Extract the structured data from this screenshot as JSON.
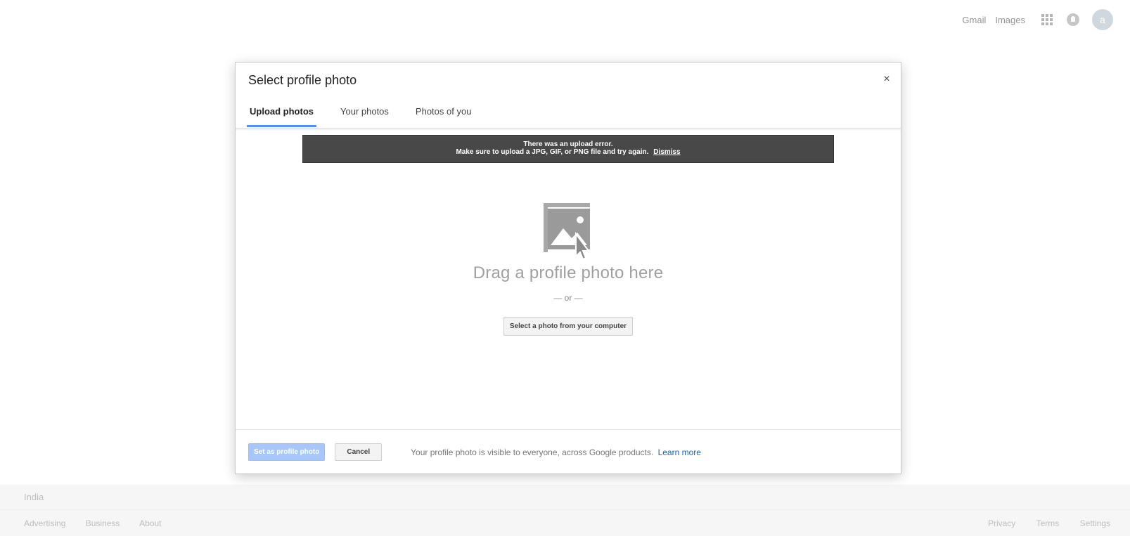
{
  "topbar": {
    "gmail": "Gmail",
    "images": "Images",
    "apps_icon": "apps-grid-icon",
    "notifications_icon": "bell-icon",
    "avatar_letter": "a"
  },
  "dialog": {
    "title": "Select profile photo",
    "close_label": "×",
    "tabs": [
      {
        "label": "Upload photos",
        "active": true
      },
      {
        "label": "Your photos",
        "active": false
      },
      {
        "label": "Photos of you",
        "active": false
      }
    ],
    "error": {
      "line1": "There was an upload error.",
      "line2": "Make sure to upload a JPG, GIF, or PNG file and try again.",
      "dismiss": "Dismiss"
    },
    "drop": {
      "icon": "photo-drag-icon",
      "text": "Drag a profile photo here",
      "or": "— or —",
      "select_button": "Select a photo from your computer"
    },
    "footer": {
      "primary": "Set as profile photo",
      "cancel": "Cancel",
      "note": "Your profile photo is visible to everyone, across Google products.",
      "learn_more": "Learn more"
    }
  },
  "footer": {
    "country": "India",
    "left_links": [
      "Advertising",
      "Business",
      "About"
    ],
    "right_links": [
      "Privacy",
      "Terms",
      "Settings"
    ]
  },
  "colors": {
    "accent": "#4d90fe",
    "error_bg": "#484848",
    "primary_disabled": "#a6c7fb",
    "link": "#1a5fb4"
  }
}
